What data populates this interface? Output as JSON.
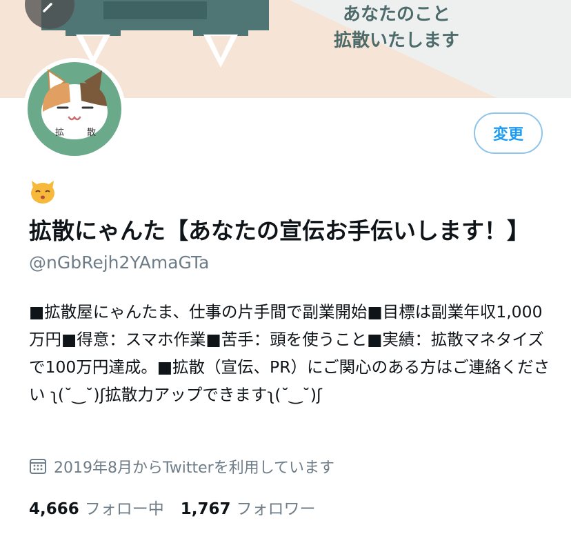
{
  "banner": {
    "text_line1": "あなたのこと",
    "text_line2": "拡散いたします"
  },
  "avatar": {
    "char_left": "拡",
    "char_right": "散"
  },
  "edit_button": {
    "label": "変更"
  },
  "profile": {
    "display_name": "拡散にゃんた【あなたの宣伝お手伝いします！】",
    "handle": "@nGbRejh2YAmaGTa",
    "bio": "■拡散屋にゃんたま、仕事の片手間で副業開始■目標は副業年収1,000万円■得意：スマホ作業■苦手：頭を使うこと■実績：拡散マネタイズで100万円達成。■拡散（宣伝、PR）にご関心のある方はご連絡ください ʅ(˘‿˘)ʃ拡散力アップできますʅ(˘‿˘)ʃ",
    "joined": "2019年8月からTwitterを利用しています"
  },
  "stats": {
    "following_count": "4,666",
    "following_label": "フォロー中",
    "followers_count": "1,767",
    "followers_label": "フォロワー"
  },
  "colors": {
    "accent": "#1d9bf0",
    "muted": "#6e7c87",
    "banner_bg": "#f6e4d6",
    "avatar_bg": "#6aa98a"
  }
}
